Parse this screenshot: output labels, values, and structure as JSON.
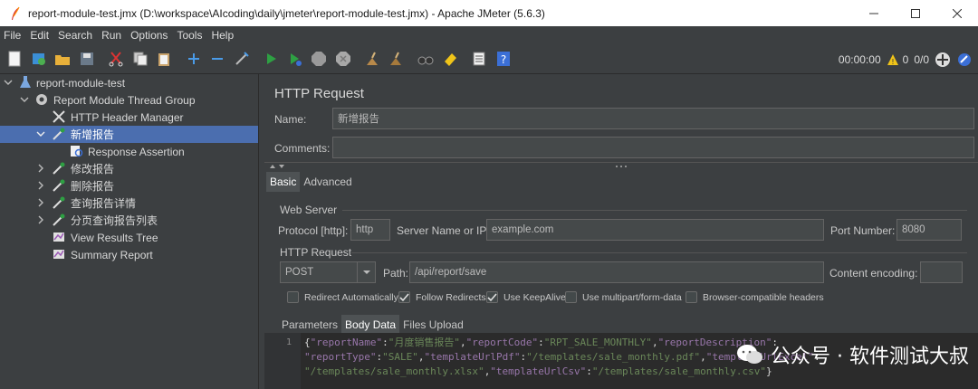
{
  "window": {
    "title": "report-module-test.jmx (D:\\workspace\\AIcoding\\daily\\jmeter\\report-module-test.jmx) - Apache JMeter (5.6.3)"
  },
  "menu": [
    "File",
    "Edit",
    "Search",
    "Run",
    "Options",
    "Tools",
    "Help"
  ],
  "toolbar": {
    "timer": "00:00:00",
    "warnings": "0",
    "threads": "0/0"
  },
  "tree": [
    {
      "label": "report-module-test",
      "icon": "flask-icon"
    },
    {
      "label": "Report Module Thread Group",
      "icon": "gear-icon"
    },
    {
      "label": "HTTP Header Manager",
      "icon": "tools-icon"
    },
    {
      "label": "新增报告",
      "icon": "pipette-icon"
    },
    {
      "label": "Response Assertion",
      "icon": "assertion-icon"
    },
    {
      "label": "修改报告",
      "icon": "pipette-icon"
    },
    {
      "label": "删除报告",
      "icon": "pipette-icon"
    },
    {
      "label": "查询报告详情",
      "icon": "pipette-icon"
    },
    {
      "label": "分页查询报告列表",
      "icon": "pipette-icon"
    },
    {
      "label": "View Results Tree",
      "icon": "listener-icon"
    },
    {
      "label": "Summary Report",
      "icon": "listener-icon"
    }
  ],
  "panel": {
    "title": "HTTP Request",
    "name_label": "Name:",
    "name_value": "新增报告",
    "comments_label": "Comments:",
    "comments_value": "",
    "tabs": [
      "Basic",
      "Advanced"
    ],
    "web_server": {
      "group_title": "Web Server",
      "protocol_label": "Protocol [http]:",
      "protocol_value": "http",
      "server_label": "Server Name or IP:",
      "server_value": "example.com",
      "port_label": "Port Number:",
      "port_value": "8080"
    },
    "http_request": {
      "group_title": "HTTP Request",
      "method": "POST",
      "path_label": "Path:",
      "path_value": "/api/report/save",
      "encoding_label": "Content encoding:",
      "encoding_value": ""
    },
    "checkboxes": [
      {
        "label": "Redirect Automatically",
        "checked": false
      },
      {
        "label": "Follow Redirects",
        "checked": true
      },
      {
        "label": "Use KeepAlive",
        "checked": true
      },
      {
        "label": "Use multipart/form-data",
        "checked": false
      },
      {
        "label": "Browser-compatible headers",
        "checked": false
      }
    ],
    "body_tabs": [
      "Parameters",
      "Body Data",
      "Files Upload"
    ],
    "line_number": "1"
  },
  "body": {
    "line1": [
      {
        "t": "{",
        "c": "p"
      },
      {
        "t": "\"reportName\"",
        "c": "k"
      },
      {
        "t": ":",
        "c": "p"
      },
      {
        "t": "\"月度销售报告\"",
        "c": "s"
      },
      {
        "t": ",",
        "c": "p"
      },
      {
        "t": "\"reportCode\"",
        "c": "k"
      },
      {
        "t": ":",
        "c": "p"
      },
      {
        "t": "\"RPT_SALE_MONTHLY\"",
        "c": "s"
      },
      {
        "t": ",",
        "c": "p"
      },
      {
        "t": "\"reportDescription\"",
        "c": "k"
      },
      {
        "t": ":",
        "c": "p"
      }
    ],
    "line2": [
      {
        "t": "\"reportType\"",
        "c": "k"
      },
      {
        "t": ":",
        "c": "p"
      },
      {
        "t": "\"SALE\"",
        "c": "s"
      },
      {
        "t": ",",
        "c": "p"
      },
      {
        "t": "\"templateUrlPdf\"",
        "c": "k"
      },
      {
        "t": ":",
        "c": "p"
      },
      {
        "t": "\"/templates/sale_monthly.pdf\"",
        "c": "s"
      },
      {
        "t": ",",
        "c": "p"
      },
      {
        "t": "\"templateUrlExcel\"",
        "c": "k"
      },
      {
        "t": ":",
        "c": "p"
      }
    ],
    "line3": [
      {
        "t": "\"/templates/sale_monthly.xlsx\"",
        "c": "s"
      },
      {
        "t": ",",
        "c": "p"
      },
      {
        "t": "\"templateUrlCsv\"",
        "c": "k"
      },
      {
        "t": ":",
        "c": "p"
      },
      {
        "t": "\"/templates/sale_monthly.csv\"",
        "c": "s"
      },
      {
        "t": "}",
        "c": "p"
      }
    ]
  },
  "watermark": "公众号 · 软件测试大叔"
}
